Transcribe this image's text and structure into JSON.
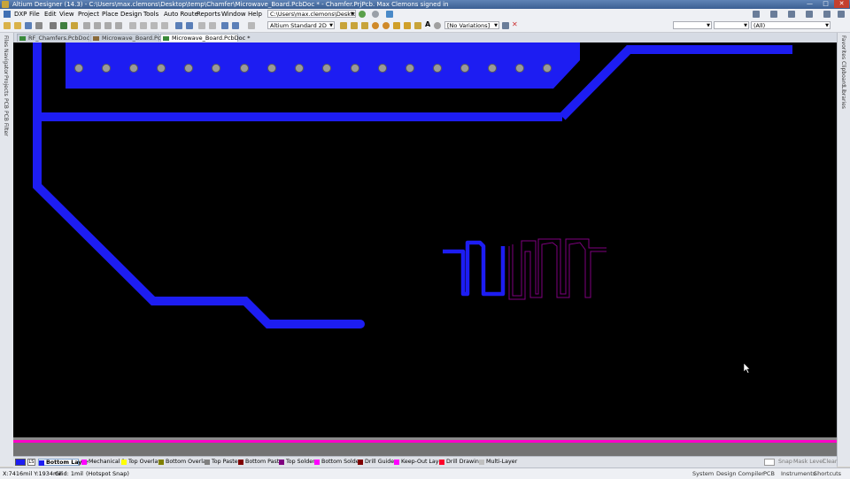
{
  "window": {
    "title": "Altium Designer (14.3) - C:\\Users\\max.clemons\\Desktop\\temp\\Chamfer\\Microwave_Board.PcbDoc * - Chamfer.PrjPcb. Max Clemons signed in"
  },
  "menu": {
    "items": [
      "DXP",
      "File",
      "Edit",
      "View",
      "Project",
      "Place",
      "Design",
      "Tools",
      "Auto Route",
      "Reports",
      "Window",
      "Help"
    ],
    "path_combo": "C:\\Users\\max.clemons\\Desktop\\te",
    "view_combo": "Altium Standard 2D",
    "variations_combo": "[No Variations]",
    "filter_combo": "(All)"
  },
  "tabs": [
    {
      "label": "RF_Chamfers.PcbDoc *",
      "active": false
    },
    {
      "label": "Microwave_Board.PcbLib",
      "active": false
    },
    {
      "label": "Microwave_Board.PcbDoc *",
      "active": true
    }
  ],
  "left_panels": [
    "Files",
    "Navigator",
    "Projects",
    "PCB",
    "PCB Filter"
  ],
  "right_panels": [
    "Favorites",
    "Clipboard",
    "Libraries"
  ],
  "layers": {
    "current_color": "#1d1df2",
    "items": [
      {
        "label": "Bottom Layer",
        "color": "#1d1df2",
        "active": true
      },
      {
        "label": "Mechanical 1",
        "color": "#ff00ff",
        "active": false
      },
      {
        "label": "Top Overlay",
        "color": "#ffff00",
        "active": false
      },
      {
        "label": "Bottom Overlay",
        "color": "#808000",
        "active": false
      },
      {
        "label": "Top Paste",
        "color": "#808080",
        "active": false
      },
      {
        "label": "Bottom Paste",
        "color": "#800000",
        "active": false
      },
      {
        "label": "Top Solder",
        "color": "#800080",
        "active": false
      },
      {
        "label": "Bottom Solder",
        "color": "#ff00ff",
        "active": false
      },
      {
        "label": "Drill Guide",
        "color": "#800000",
        "active": false
      },
      {
        "label": "Keep-Out Layer",
        "color": "#ff00ff",
        "active": false
      },
      {
        "label": "Drill Drawing",
        "color": "#ff002a",
        "active": false
      },
      {
        "label": "Multi-Layer",
        "color": "#c0c0c0",
        "active": false
      }
    ],
    "controls": [
      "Snap",
      "Mask Level",
      "Clear"
    ]
  },
  "status": {
    "coords": "X:7416mil Y:1934mil",
    "grid": "Grid: 1mil",
    "snap": "(Hotspot Snap)",
    "panels": [
      "System",
      "Design Compiler",
      "PCB",
      "Instruments",
      "Shortcuts"
    ]
  },
  "colors": {
    "canvas": "#000000",
    "bottom_trace": "#1d1df2",
    "top_solder_outline": "#800080",
    "board_edge": "#ff00c8",
    "via": "#9a9a9a"
  }
}
